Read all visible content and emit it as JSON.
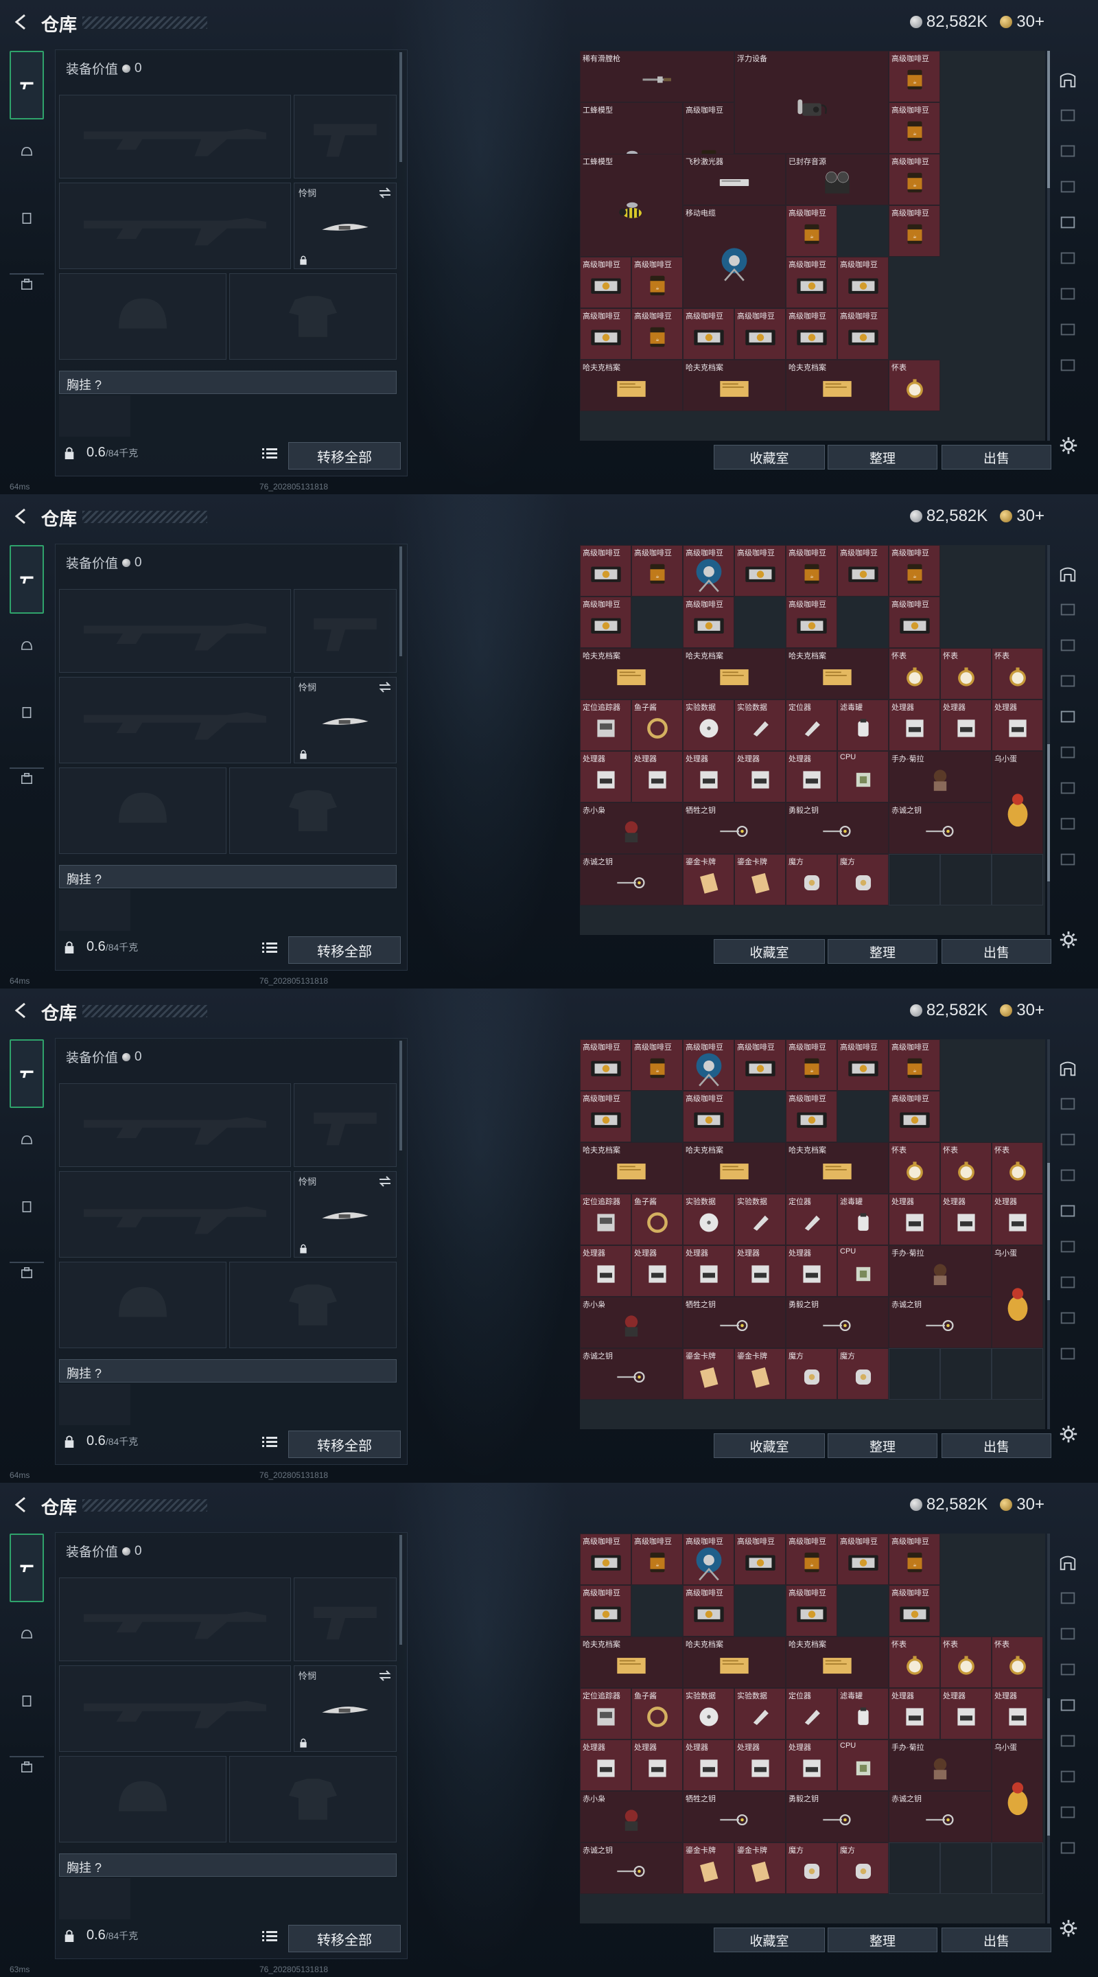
{
  "header": {
    "title": "仓库",
    "coins": "82,582K",
    "gold": "30+"
  },
  "equipment": {
    "value_label": "装备价值",
    "value": "0",
    "melee_label": "怜悯",
    "chest_label": "胸挂 ?"
  },
  "weight": {
    "current": "0.6",
    "max": "/84千克"
  },
  "buttons": {
    "transfer_all": "转移全部",
    "collection": "收藏室",
    "organize": "整理",
    "sell": "出售"
  },
  "labels": {
    "rare_rifle": "稀有滑膛枪",
    "float_device": "浮力设备",
    "premium_coffee": "高级咖啡豆",
    "worker_bee": "工蜂模型",
    "laser": "飞秒激光器",
    "sealed_source": "已封存音源",
    "mobile_power": "移动电缆",
    "hafu_file": "哈夫克档案",
    "pocket_watch": "怀表",
    "locator": "定位追踪器",
    "fish_bait": "鱼子酱",
    "data_disk": "实验数据",
    "locator2": "定位器",
    "filter_can": "滤毒罐",
    "processor": "处理器",
    "cpu": "CPU",
    "figure_1": "手办·菊拉",
    "egg": "乌小蛋",
    "figure_2": "赤小枭",
    "key_1": "牺牲之钥",
    "key_2": "勇毅之钥",
    "key_3": "赤诚之钥",
    "gold_card": "鎏金卡牌",
    "cube": "魔方"
  },
  "frames": [
    {
      "ping": "64ms",
      "build": "76_202805131818"
    },
    {
      "ping": "64ms",
      "build": "76_202805131818"
    },
    {
      "ping": "64ms",
      "build": "76_202805131818"
    },
    {
      "ping": "63ms",
      "build": "76_202805131818"
    }
  ],
  "colors": {
    "accent": "#2fa36b",
    "cell_bg": "#5a2630",
    "cell_bg_dark": "#3a1e26"
  }
}
